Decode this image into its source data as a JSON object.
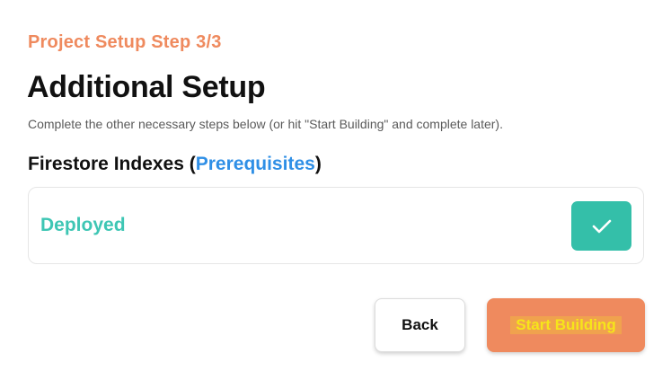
{
  "header": {
    "step_label": "Project Setup Step 3/3",
    "title": "Additional Setup",
    "subtitle": "Complete the other necessary steps below (or hit \"Start Building\" and complete later)."
  },
  "section": {
    "heading_prefix": "Firestore Indexes (",
    "heading_link": "Prerequisites",
    "heading_suffix": ")",
    "status": "Deployed",
    "status_icon": "checkmark-icon"
  },
  "actions": {
    "back_label": "Back",
    "start_label": "Start Building"
  },
  "colors": {
    "accent": "#ef8a5e",
    "link": "#2f8fe6",
    "success": "#3ec6b4",
    "success_button": "#34bfa9"
  }
}
